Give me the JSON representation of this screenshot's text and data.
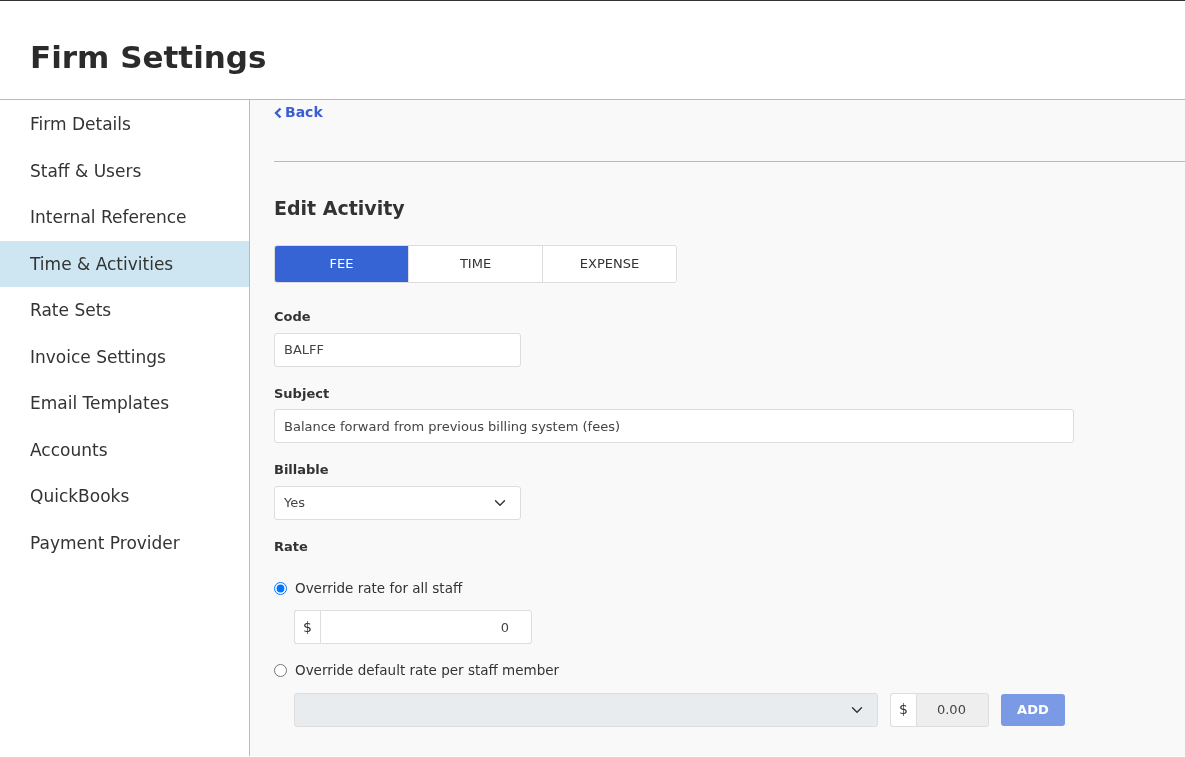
{
  "page_title": "Firm Settings",
  "sidebar": {
    "items": [
      {
        "label": "Firm Details",
        "selected": false
      },
      {
        "label": "Staff & Users",
        "selected": false
      },
      {
        "label": "Internal Reference",
        "selected": false
      },
      {
        "label": "Time & Activities",
        "selected": true
      },
      {
        "label": "Rate Sets",
        "selected": false
      },
      {
        "label": "Invoice Settings",
        "selected": false
      },
      {
        "label": "Email Templates",
        "selected": false
      },
      {
        "label": "Accounts",
        "selected": false
      },
      {
        "label": "QuickBooks",
        "selected": false
      },
      {
        "label": "Payment Provider",
        "selected": false
      }
    ]
  },
  "back_link": "Back",
  "heading": "Edit Activity",
  "tabs": [
    {
      "label": "FEE",
      "selected": true
    },
    {
      "label": "TIME",
      "selected": false
    },
    {
      "label": "EXPENSE",
      "selected": false
    }
  ],
  "code": {
    "label": "Code",
    "value": "BALFF"
  },
  "subject": {
    "label": "Subject",
    "value": "Balance forward from previous billing system (fees)"
  },
  "billable": {
    "label": "Billable",
    "value": "Yes"
  },
  "rate": {
    "label": "Rate",
    "options": [
      {
        "label": "Override rate for all staff",
        "selected": true
      },
      {
        "label": "Override default rate per staff member",
        "selected": false
      }
    ],
    "all_staff": {
      "currency": "$",
      "value": "0",
      "disabled": false
    },
    "per_staff": {
      "staff_disabled": true,
      "currency": "$",
      "value": "0.00",
      "disabled": true
    },
    "add_button": {
      "label": "ADD",
      "disabled": true
    }
  }
}
